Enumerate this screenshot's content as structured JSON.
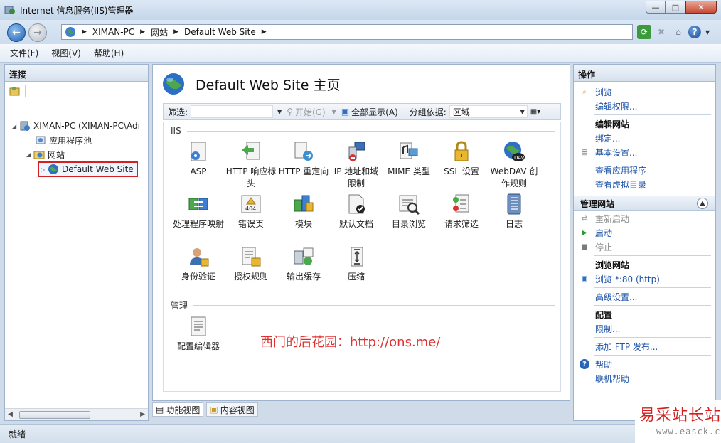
{
  "window": {
    "title": "Internet 信息服务(IIS)管理器"
  },
  "address": {
    "crumbs": [
      "XIMAN-PC",
      "网站",
      "Default Web Site"
    ]
  },
  "menu": {
    "file": "文件(F)",
    "view": "视图(V)",
    "help": "帮助(H)"
  },
  "connections": {
    "header": "连接",
    "tree": {
      "server": "XIMAN-PC (XIMAN-PC\\Adı",
      "app_pools": "应用程序池",
      "sites": "网站",
      "default_site": "Default Web Site"
    }
  },
  "center": {
    "title": "Default Web Site 主页",
    "filter_label": "筛选:",
    "start_label": "开始(G)",
    "show_all_label": "全部显示(A)",
    "group_by_label": "分组依据:",
    "group_by_value": "区域",
    "section_iis": "IIS",
    "section_manage": "管理",
    "features_row1": [
      "ASP",
      "HTTP 响应标头",
      "HTTP 重定向",
      "IP 地址和域限制",
      "MIME 类型",
      "SSL 设置",
      "WebDAV 创作规则"
    ],
    "features_row2": [
      "处理程序映射",
      "错误页",
      "模块",
      "默认文档",
      "目录浏览",
      "请求筛选",
      "日志"
    ],
    "features_row3": [
      "身份验证",
      "授权规则",
      "输出缓存",
      "压缩"
    ],
    "features_manage": [
      "配置编辑器"
    ],
    "watermark": "西门的后花园：http://ons.me/"
  },
  "bottom_tabs": {
    "features_view": "功能视图",
    "content_view": "内容视图"
  },
  "actions": {
    "header": "操作",
    "browse": "浏览",
    "edit_permissions": "编辑权限...",
    "edit_site": "编辑网站",
    "bindings": "绑定...",
    "basic_settings": "基本设置...",
    "view_apps": "查看应用程序",
    "view_vdirs": "查看虚拟目录",
    "manage_site": "管理网站",
    "restart": "重新启动",
    "start": "启动",
    "stop": "停止",
    "browse_site": "浏览网站",
    "browse_port": "浏览 *:80 (http)",
    "advanced": "高级设置...",
    "config": "配置",
    "limits": "限制...",
    "add_ftp": "添加 FTP 发布...",
    "help": "帮助",
    "online_help": "联机帮助"
  },
  "status": {
    "text": "就绪"
  },
  "brand": {
    "name": "易采站长站",
    "url": "www.easck.com"
  }
}
